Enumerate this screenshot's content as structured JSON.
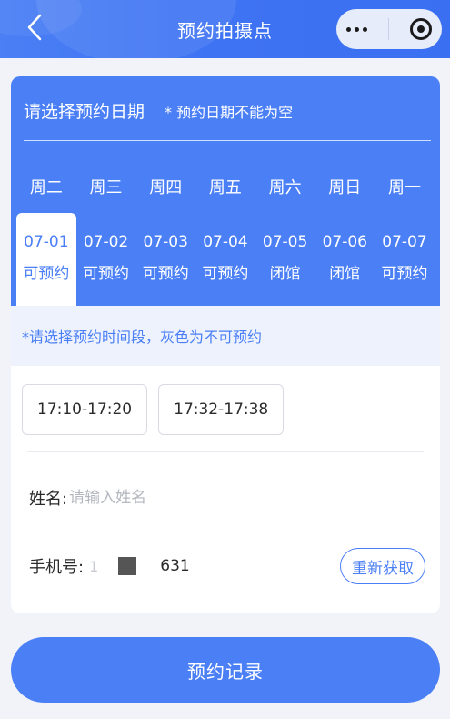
{
  "header": {
    "title": "预约拍摄点",
    "back_icon": "chevron-left-icon",
    "more_icon": "more-dots-icon",
    "close_icon": "target-circle-icon"
  },
  "date_section": {
    "heading": "请选择预约日期",
    "required_note": "* 预约日期不能为空",
    "weekdays": [
      "周二",
      "周三",
      "周四",
      "周五",
      "周六",
      "周日",
      "周一"
    ],
    "days": [
      {
        "date": "07-01",
        "status": "可预约",
        "selected": true
      },
      {
        "date": "07-02",
        "status": "可预约",
        "selected": false
      },
      {
        "date": "07-03",
        "status": "可预约",
        "selected": false
      },
      {
        "date": "07-04",
        "status": "可预约",
        "selected": false
      },
      {
        "date": "07-05",
        "status": "闭馆",
        "selected": false
      },
      {
        "date": "07-06",
        "status": "闭馆",
        "selected": false
      },
      {
        "date": "07-07",
        "status": "可预约",
        "selected": false
      }
    ]
  },
  "time_section": {
    "hint": "*请选择预约时间段，灰色为不可预约",
    "slots": [
      "17:10-17:20",
      "17:32-17:38"
    ]
  },
  "form": {
    "name_label": "姓名:",
    "name_placeholder": "请输入姓名",
    "phone_label": "手机号:",
    "phone_prefix": "1",
    "phone_suffix": "631",
    "refresh_label": "重新获取"
  },
  "footer": {
    "record_button": "预约记录"
  },
  "colors": {
    "primary": "#4a7ff6",
    "hint_bg": "#eef2fd",
    "page_bg": "#f2f3f8"
  }
}
